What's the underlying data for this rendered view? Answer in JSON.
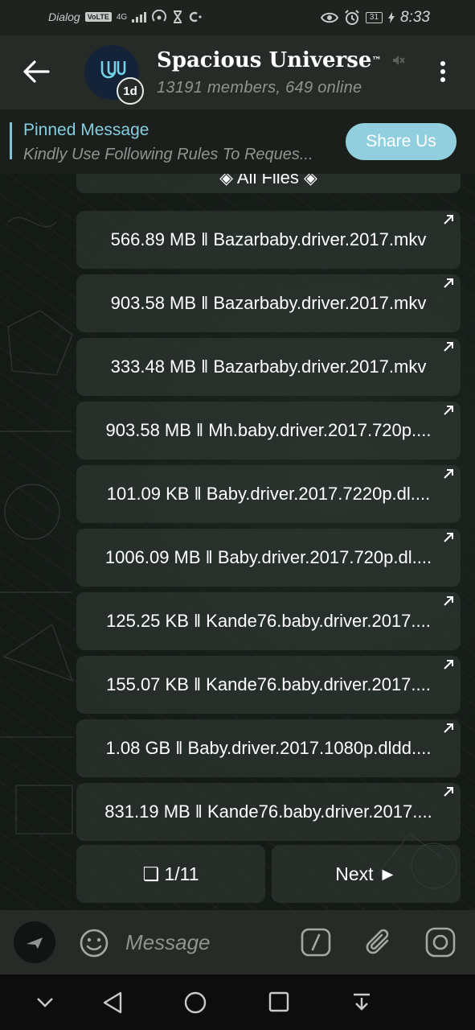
{
  "status_bar": {
    "carrier": "Dialog",
    "volte": "VoLTE",
    "network": "4G",
    "battery": "31",
    "time": "8:33"
  },
  "header": {
    "title": "Spacious Universe",
    "title_mark": "™",
    "subtitle": "13191 members, 649 online",
    "avatar_badge": "1d"
  },
  "pinned": {
    "title": "Pinned Message",
    "text": "Kindly Use Following Rules To Reques...",
    "share_label": "Share Us"
  },
  "keyboard": {
    "header_label": "◈ All Files ◈",
    "files": [
      "566.89 MB ‖ Bazarbaby.driver.2017.mkv",
      "903.58 MB ‖ Bazarbaby.driver.2017.mkv",
      "333.48 MB ‖ Bazarbaby.driver.2017.mkv",
      "903.58 MB ‖ Mh.baby.driver.2017.720p....",
      "101.09 KB ‖ Baby.driver.2017.7220p.dl....",
      "1006.09 MB ‖ Baby.driver.2017.720p.dl....",
      "125.25 KB ‖ Kande76.baby.driver.2017....",
      "155.07 KB ‖ Kande76.baby.driver.2017....",
      "1.08 GB ‖ Baby.driver.2017.1080p.dldd....",
      "831.19 MB ‖ Kande76.baby.driver.2017...."
    ],
    "page_label": "❏ 1/11",
    "next_label": "Next ►"
  },
  "input": {
    "placeholder": "Message"
  },
  "icons": {
    "back": "arrow-left-icon",
    "mute": "mute-icon",
    "menu": "more-vertical-icon",
    "open_link": "arrow-up-right-icon",
    "emoji": "smile-icon",
    "command": "slash-command-icon",
    "attach": "paperclip-icon",
    "camera": "instagram-camera-icon",
    "nav": [
      "chevron-down-icon",
      "back-triangle-icon",
      "home-circle-icon",
      "recents-square-icon",
      "notifications-down-icon"
    ]
  },
  "colors": {
    "accent": "#86cde0",
    "share_button": "#91cfdf",
    "header_bg": "#262b27",
    "button_bg": "#323a36"
  }
}
